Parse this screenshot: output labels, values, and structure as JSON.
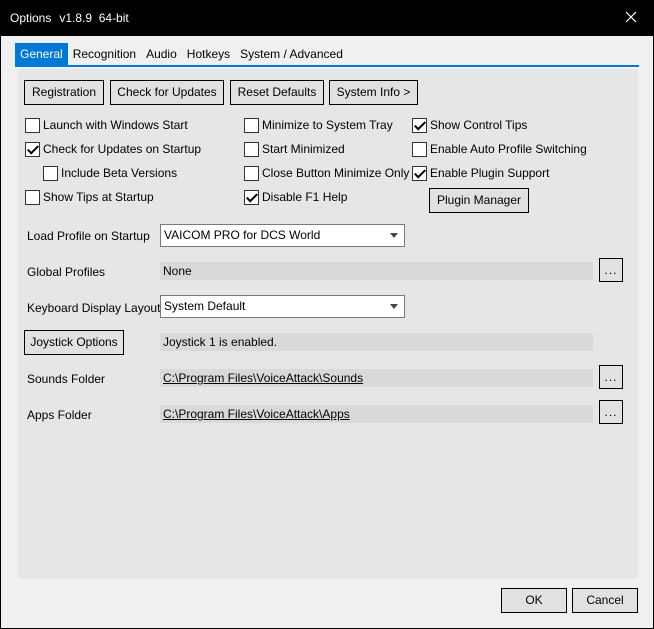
{
  "window": {
    "title": "Options",
    "version": "v1.8.9  64-bit",
    "accent_color": "#0078d7"
  },
  "tabs": [
    {
      "label": "General",
      "active": true
    },
    {
      "label": "Recognition",
      "active": false
    },
    {
      "label": "Audio",
      "active": false
    },
    {
      "label": "Hotkeys",
      "active": false
    },
    {
      "label": "System / Advanced",
      "active": false
    }
  ],
  "top_buttons": {
    "registration": "Registration",
    "check_updates": "Check for Updates",
    "reset_defaults": "Reset Defaults",
    "system_info": "System Info >"
  },
  "checkboxes": {
    "launch_with_windows": {
      "label": "Launch with Windows Start",
      "checked": false
    },
    "check_updates_startup": {
      "label": "Check for Updates on Startup",
      "checked": true
    },
    "include_beta": {
      "label": "Include Beta Versions",
      "checked": false
    },
    "show_tips": {
      "label": "Show Tips at Startup",
      "checked": false
    },
    "minimize_tray": {
      "label": "Minimize to System Tray",
      "checked": false
    },
    "start_minimized": {
      "label": "Start Minimized",
      "checked": false
    },
    "close_minimize": {
      "label": "Close Button Minimize Only",
      "checked": false
    },
    "disable_f1": {
      "label": "Disable F1 Help",
      "checked": true
    },
    "show_control_tips": {
      "label": "Show Control Tips",
      "checked": true
    },
    "auto_profile": {
      "label": "Enable Auto Profile Switching",
      "checked": false
    },
    "plugin_support": {
      "label": "Enable Plugin Support",
      "checked": true
    }
  },
  "plugin_manager_label": "Plugin Manager",
  "load_profile": {
    "label": "Load Profile on Startup",
    "value": "VAICOM PRO for DCS World"
  },
  "global_profiles": {
    "label": "Global Profiles",
    "value": "None",
    "browse": "..."
  },
  "keyboard_layout": {
    "label": "Keyboard Display Layout",
    "value": "System Default"
  },
  "joystick": {
    "button": "Joystick Options",
    "status": "Joystick 1 is enabled."
  },
  "sounds_folder": {
    "label": "Sounds Folder",
    "value": "C:\\Program Files\\VoiceAttack\\Sounds",
    "browse": "..."
  },
  "apps_folder": {
    "label": "Apps Folder",
    "value": "C:\\Program Files\\VoiceAttack\\Apps",
    "browse": "..."
  },
  "footer": {
    "ok": "OK",
    "cancel": "Cancel"
  },
  "icons": {
    "close": "close-icon",
    "dropdown": "chevron-down-icon",
    "checkmark": "checkmark-icon"
  }
}
